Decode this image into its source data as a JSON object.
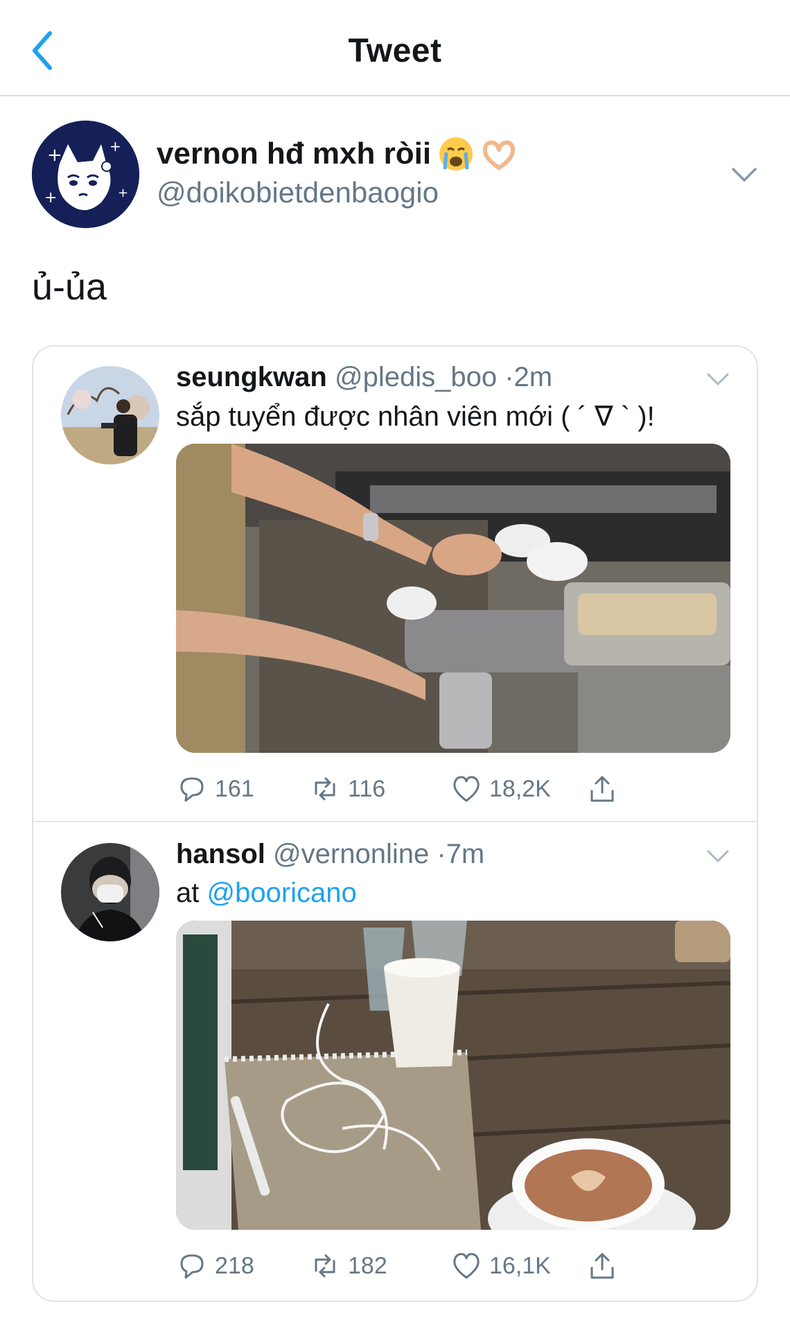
{
  "header": {
    "title": "Tweet"
  },
  "tweet": {
    "display_name": "vernon hđ mxh ròii",
    "handle": "@doikobietdenbaogio",
    "name_emojis": [
      "crying-face-emoji",
      "heart-hands-emoji"
    ],
    "text": "ủ-ủa"
  },
  "quoted_tweets": [
    {
      "name": "seungkwan",
      "handle": "@pledis_boo",
      "separator": "·",
      "time": "2m",
      "text": "sắp tuyển được nhân viên mới ( ´ ∇ ` )!",
      "media": "barista-pouring-coffee-photo",
      "stats": {
        "replies": "161",
        "retweets": "116",
        "likes": "18,2K"
      }
    },
    {
      "name": "hansol",
      "handle": "@vernonline",
      "separator": "·",
      "time": "7m",
      "text_prefix": "at ",
      "mention": "@booricano",
      "media": "cafe-table-latte-photo",
      "stats": {
        "replies": "218",
        "retweets": "182",
        "likes": "16,1K"
      }
    }
  ],
  "colors": {
    "accent": "#1da1f2",
    "secondary_text": "#657786",
    "text": "#14171a"
  }
}
